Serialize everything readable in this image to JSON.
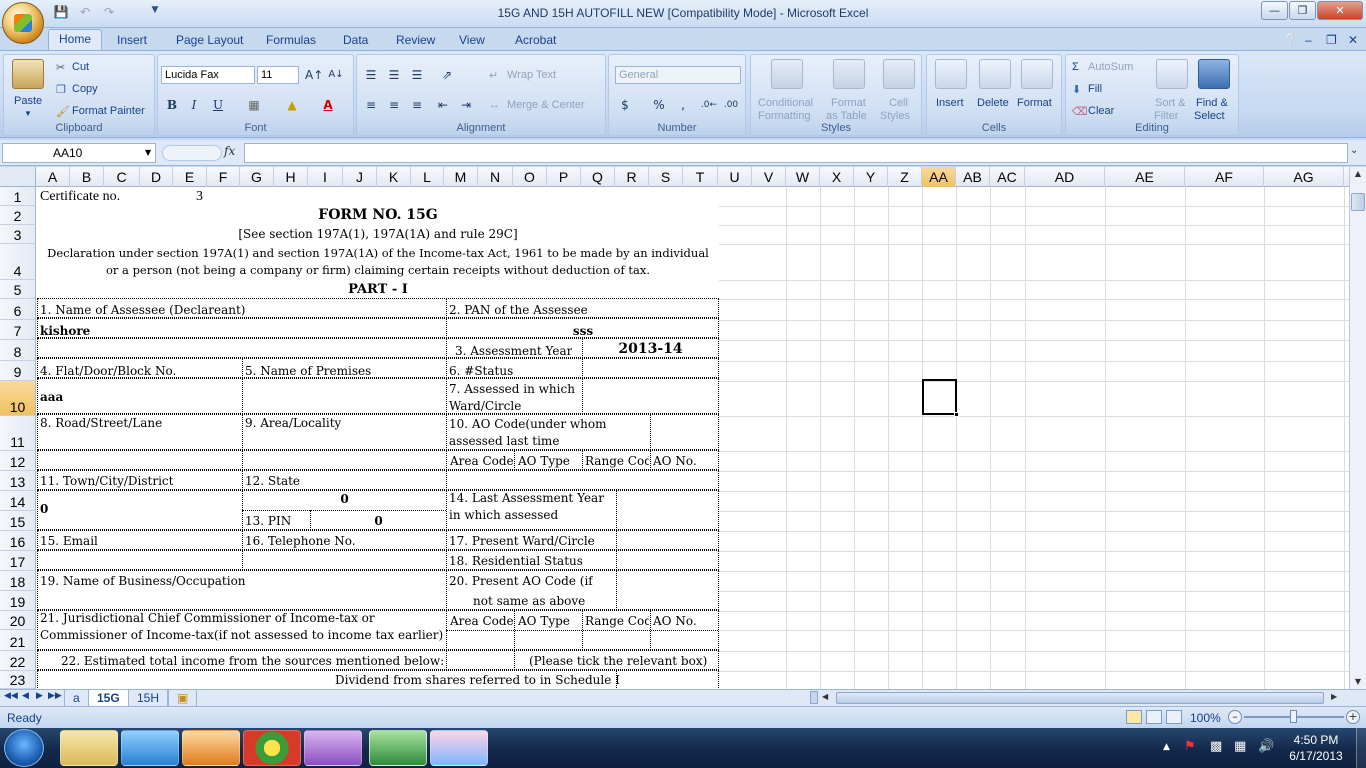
{
  "window": {
    "title": "15G AND 15H AUTOFILL NEW  [Compatibility Mode] - Microsoft Excel"
  },
  "ribbon_tabs": [
    "Home",
    "Insert",
    "Page Layout",
    "Formulas",
    "Data",
    "Review",
    "View",
    "Acrobat"
  ],
  "ribbon": {
    "clipboard": {
      "label": "Clipboard",
      "paste": "Paste",
      "cut": "Cut",
      "copy": "Copy",
      "format_painter": "Format Painter"
    },
    "font": {
      "label": "Font",
      "font_name": "Lucida Fax",
      "font_size": "11",
      "bold": "B",
      "italic": "I",
      "underline": "U"
    },
    "alignment": {
      "label": "Alignment",
      "wrap_text": "Wrap Text",
      "merge_center": "Merge & Center"
    },
    "number": {
      "label": "Number",
      "format": "General",
      "currency": "$",
      "percent": "%",
      "comma": ","
    },
    "styles": {
      "label": "Styles",
      "conditional_1": "Conditional",
      "conditional_2": "Formatting",
      "format_table_1": "Format",
      "format_table_2": "as Table",
      "cell_styles_1": "Cell",
      "cell_styles_2": "Styles"
    },
    "cells": {
      "label": "Cells",
      "insert": "Insert",
      "delete": "Delete",
      "format": "Format"
    },
    "editing": {
      "label": "Editing",
      "autosum": "AutoSum",
      "fill": "Fill",
      "clear": "Clear",
      "sort_1": "Sort &",
      "sort_2": "Filter",
      "find_1": "Find &",
      "find_2": "Select"
    }
  },
  "formula_bar": {
    "name_box": "AA10",
    "fx": "fx",
    "formula": ""
  },
  "columns": [
    "A",
    "B",
    "C",
    "D",
    "E",
    "F",
    "G",
    "H",
    "I",
    "J",
    "K",
    "L",
    "M",
    "N",
    "O",
    "P",
    "Q",
    "R",
    "S",
    "T",
    "U",
    "V",
    "W",
    "X",
    "Y",
    "Z",
    "AA",
    "AB",
    "AC",
    "AD",
    "AE",
    "AF",
    "AG"
  ],
  "rows": [
    "1",
    "2",
    "3",
    "4",
    "5",
    "6",
    "7",
    "8",
    "9",
    "10",
    "11",
    "12",
    "13",
    "14",
    "15",
    "16",
    "17",
    "18",
    "19",
    "20",
    "21",
    "22",
    "23"
  ],
  "selected_cell": "AA10",
  "sheet": {
    "certificate_label": "Certificate no.",
    "certificate_no": "3",
    "form_title": "FORM NO. 15G",
    "form_subtitle": "[See section 197A(1),  197A(1A) and rule 29C]",
    "declaration_line1": "Declaration under section 197A(1) and section 197A(1A) of the Income-tax Act, 1961 to be made by an individual",
    "declaration_line2": "or a person (not being a company or firm) claiming certain receipts without deduction of tax.",
    "part": "PART - I",
    "f1": "1. Name of Assessee (Declareant)",
    "f2": "2. PAN of the Assessee",
    "name_value": "kishore",
    "pan_value": "sss",
    "f3": "3. Assessment Year",
    "year_value": "2013-14",
    "f4": "4. Flat/Door/Block No.",
    "f5": "5. Name of Premises",
    "f6": "6. #Status",
    "f7_line1": "7. Assessed in which",
    "f7_line2": "Ward/Circle",
    "flat_value": "aaa",
    "f8": "8. Road/Street/Lane",
    "f9": "9. Area/Locality",
    "f10_line1": "10. AO Code(under whom",
    "f10_line2": "assessed last time",
    "area_code": "Area Code",
    "ao_type": "AO Type",
    "range_code": "Range Cod",
    "ao_no": "AO No.",
    "f11": "11. Town/City/District",
    "f12": "12. State",
    "state_value": "0",
    "f14_line1": "14. Last Assessment Year",
    "f14_line2": "in which assessed",
    "town_value": "0",
    "f13": "13. PIN",
    "pin_value": "0",
    "f15": "15. Email",
    "f16": "16. Telephone No.",
    "f17": "17. Present Ward/Circle",
    "f18": "18. Residential Status",
    "f19": "19. Name of Business/Occupation",
    "f20_line1": "20. Present AO Code (if",
    "f20_line2": "not same as above",
    "f21_line1": "21. Jurisdictional Chief Commissioner of Income-tax or",
    "f21_line2": "Commissioner of Income-tax(if not assessed to income tax earlier)",
    "f22": "22. Estimated total income from the sources mentioned below:",
    "tick": "(Please tick the relevant box)",
    "dividend": "Dividend from shares referred to in Schedule I"
  },
  "sheet_tabs": [
    "a",
    "15G",
    "15H"
  ],
  "active_sheet": "15G",
  "status": {
    "mode": "Ready",
    "zoom": "100%"
  },
  "taskbar": {
    "time": "4:50 PM",
    "date": "6/17/2013"
  },
  "colors": {
    "selection_header": "#f1c15f",
    "ribbon_bg": "#c6d9f1",
    "taskbar_bg": "#13284a"
  }
}
